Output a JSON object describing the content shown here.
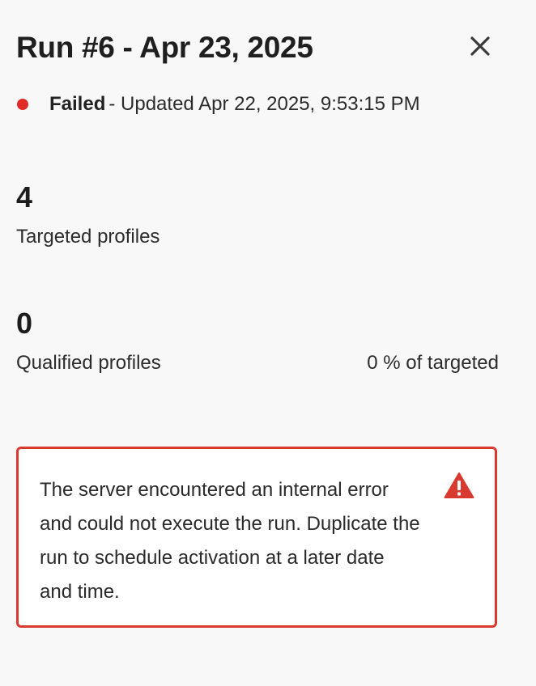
{
  "header": {
    "title": "Run #6 - Apr 23, 2025",
    "close_icon": "close-icon"
  },
  "status": {
    "label": "Failed",
    "separator": "- ",
    "updated_text": "Updated Apr 22, 2025, 9:53:15 PM",
    "color": "#e02b26"
  },
  "metrics": {
    "targeted": {
      "value": "4",
      "label": "Targeted profiles"
    },
    "qualified": {
      "value": "0",
      "label": "Qualified profiles",
      "percent_text": "0 % of targeted"
    }
  },
  "error": {
    "message": "The server encountered an internal error and could not execute the run. Duplicate the run to schedule activation at a later date and time.",
    "icon": "alert-triangle-icon",
    "border_color": "#d93a2f"
  }
}
